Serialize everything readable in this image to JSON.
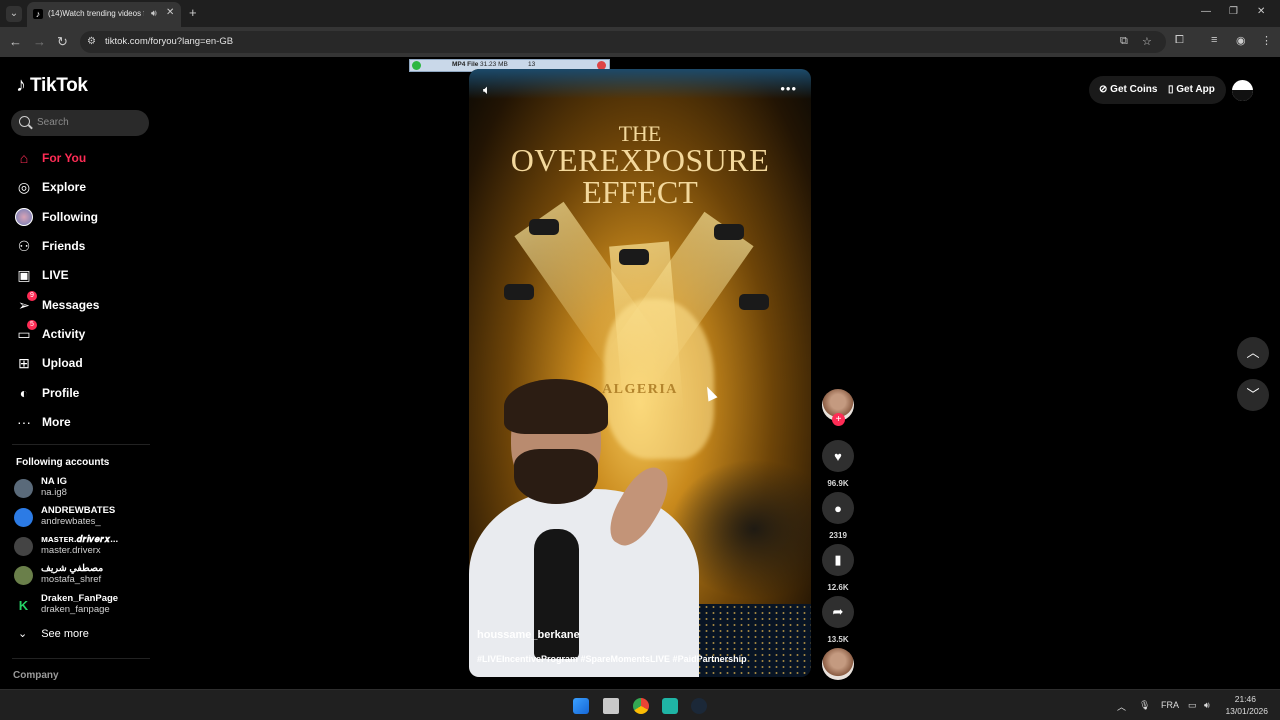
{
  "browser": {
    "tab_title": "(14)Watch trending videos f",
    "url": "tiktok.com/foryou?lang=en-GB"
  },
  "sidebar": {
    "logo": "TikTok",
    "search_placeholder": "Search",
    "nav": [
      {
        "label": "For You",
        "icon": "home-icon",
        "active": true
      },
      {
        "label": "Explore",
        "icon": "compass-icon"
      },
      {
        "label": "Following",
        "icon": "following-avatar-icon"
      },
      {
        "label": "Friends",
        "icon": "friends-icon"
      },
      {
        "label": "LIVE",
        "icon": "live-tv-icon"
      },
      {
        "label": "Messages",
        "icon": "messages-icon",
        "badge": "9"
      },
      {
        "label": "Activity",
        "icon": "activity-icon",
        "badge": "5"
      },
      {
        "label": "Upload",
        "icon": "upload-icon"
      },
      {
        "label": "Profile",
        "icon": "profile-icon"
      },
      {
        "label": "More",
        "icon": "more-dots-icon"
      }
    ],
    "following_title": "Following accounts",
    "accounts": [
      {
        "name": "NA IG",
        "handle": "na.ig8",
        "color": "#5a6a7a"
      },
      {
        "name": "ANDREWBATES",
        "handle": "andrewbates_",
        "color": "#2c7be5"
      },
      {
        "name": "ᴍᴀsᴛᴇʀ.𝒅𝒓𝒊𝒗𝒆𝒓𝒙...",
        "handle": "master.driverx",
        "color": "#444444"
      },
      {
        "name": "مصطفي شريف",
        "handle": "mostafa_shref",
        "color": "#6a7f4a"
      },
      {
        "name": "Draken_FanPage",
        "handle": "draken_fanpage",
        "color": "#25d366"
      }
    ],
    "see_more": "See more",
    "company": "Company"
  },
  "overlay": {
    "label": "MP4 File",
    "size": "31.23 MB",
    "extra": "13"
  },
  "video": {
    "title_line1": "THE",
    "title_line2": "OVEREXPOSURE",
    "title_line3": "EFFECT",
    "map_label": "ALGERIA",
    "author": "houssame_berkane",
    "description": "#LIVEIncentiveProgram #SpareMomentsLIVE #PaidPartnership"
  },
  "actions": {
    "likes": "96.9K",
    "comments": "2319",
    "bookmarks": "12.6K",
    "shares": "13.5K"
  },
  "topbar": {
    "get_coins": "Get Coins",
    "get_app": "Get App"
  },
  "taskbar": {
    "language": "FRA",
    "time": "21:46",
    "date": "13/01/2026"
  },
  "colors": {
    "accent": "#fe2c55",
    "background": "#000000"
  }
}
